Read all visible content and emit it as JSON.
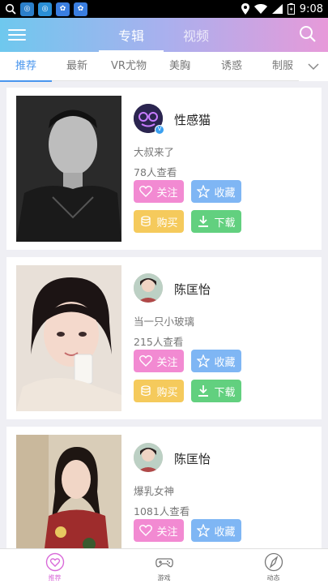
{
  "status_bar": {
    "time": "9:08",
    "notif_labels": [
      "",
      "",
      "",
      ""
    ]
  },
  "header": {
    "segments": [
      {
        "label": "专辑",
        "active": true
      },
      {
        "label": "视频",
        "active": false
      }
    ]
  },
  "tabs": [
    {
      "label": "推荐",
      "active": true
    },
    {
      "label": "最新",
      "active": false
    },
    {
      "label": "VR尤物",
      "active": false
    },
    {
      "label": "美胸",
      "active": false
    },
    {
      "label": "诱惑",
      "active": false
    },
    {
      "label": "制服",
      "active": false
    }
  ],
  "cards": [
    {
      "username": "性感猫",
      "description": "大叔来了",
      "views": "78人查看",
      "verified": true
    },
    {
      "username": "陈匡怡",
      "description": "当一只小玻璃",
      "views": "215人查看",
      "verified": false
    },
    {
      "username": "陈匡怡",
      "description": "爆乳女神",
      "views": "1081人查看",
      "verified": false
    }
  ],
  "buttons": {
    "follow": "关注",
    "favorite": "收藏",
    "buy": "购买",
    "download": "下载"
  },
  "bottom_nav": [
    {
      "label": "推荐",
      "icon": "heart-icon",
      "active": true
    },
    {
      "label": "游戏",
      "icon": "gamepad-icon",
      "active": false
    },
    {
      "label": "动态",
      "icon": "compass-icon",
      "active": false
    }
  ],
  "colors": {
    "accent_blue": "#4a96ee",
    "follow_pink": "#f28ad2",
    "favorite_blue": "#7fb6f4",
    "buy_yellow": "#f5ca5c",
    "download_green": "#62d07f",
    "nav_active": "#d96ad9"
  }
}
